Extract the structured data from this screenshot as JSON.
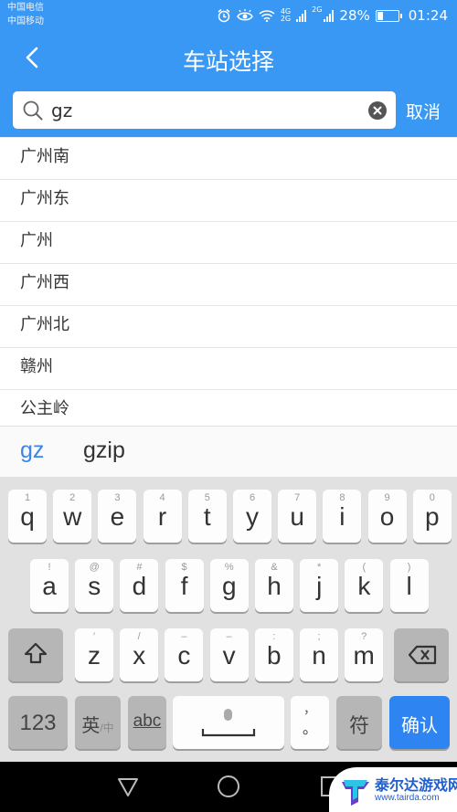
{
  "status_bar": {
    "carrier_1": "中国电信",
    "carrier_2": "中国移动",
    "icons": [
      "alarm-icon",
      "eye-comfort-icon",
      "wifi-icon",
      "signal-4g-icon",
      "signal-2g-icon"
    ],
    "signal_1_label_top": "4G",
    "signal_1_label_bottom": "2G",
    "signal_2_label": "2G",
    "battery_percent": "28%",
    "battery_level": 0.28,
    "time": "01:24"
  },
  "header": {
    "back_icon": "chevron-left-icon",
    "title": "车站选择"
  },
  "search": {
    "icon": "search-icon",
    "value": "gz",
    "clear_icon": "clear-icon",
    "cancel_label": "取消"
  },
  "results": [
    {
      "name": "广州南"
    },
    {
      "name": "广州东"
    },
    {
      "name": "广州"
    },
    {
      "name": "广州西"
    },
    {
      "name": "广州北"
    },
    {
      "name": "赣州"
    },
    {
      "name": "公主岭"
    }
  ],
  "ime": {
    "candidates": [
      "gz",
      "gzip"
    ],
    "row1": [
      {
        "key": "q",
        "sub": "1"
      },
      {
        "key": "w",
        "sub": "2"
      },
      {
        "key": "e",
        "sub": "3"
      },
      {
        "key": "r",
        "sub": "4"
      },
      {
        "key": "t",
        "sub": "5"
      },
      {
        "key": "y",
        "sub": "6"
      },
      {
        "key": "u",
        "sub": "7"
      },
      {
        "key": "i",
        "sub": "8"
      },
      {
        "key": "o",
        "sub": "9"
      },
      {
        "key": "p",
        "sub": "0"
      }
    ],
    "row2": [
      {
        "key": "a",
        "sub": "!"
      },
      {
        "key": "s",
        "sub": "@"
      },
      {
        "key": "d",
        "sub": "#"
      },
      {
        "key": "f",
        "sub": "$"
      },
      {
        "key": "g",
        "sub": "%"
      },
      {
        "key": "h",
        "sub": "&"
      },
      {
        "key": "j",
        "sub": "*"
      },
      {
        "key": "k",
        "sub": "("
      },
      {
        "key": "l",
        "sub": ")"
      }
    ],
    "row3": [
      {
        "key": "z",
        "sub": "′"
      },
      {
        "key": "x",
        "sub": "/"
      },
      {
        "key": "c",
        "sub": "–"
      },
      {
        "key": "v",
        "sub": "–"
      },
      {
        "key": "b",
        "sub": ":"
      },
      {
        "key": "n",
        "sub": ";"
      },
      {
        "key": "m",
        "sub": "?"
      }
    ],
    "shift_icon": "shift-icon",
    "backspace_icon": "backspace-icon",
    "num_label": "123",
    "lang_label": "英",
    "lang_sub": "/中",
    "abc_label": "abc",
    "space_icon": "microphone-space-icon",
    "punct_top": "，",
    "punct_bottom": "。",
    "symbol_label": "符",
    "confirm_label": "确认"
  },
  "nav": {
    "back_icon": "nav-back-icon",
    "home_icon": "nav-home-icon",
    "recents_icon": "nav-recents-icon"
  },
  "watermark": {
    "name": "泰尔达游戏网",
    "url": "www.tairda.com"
  },
  "colors": {
    "primary": "#3a98f5",
    "confirm_key": "#2e84f0",
    "candidate_active": "#3a86e8"
  }
}
